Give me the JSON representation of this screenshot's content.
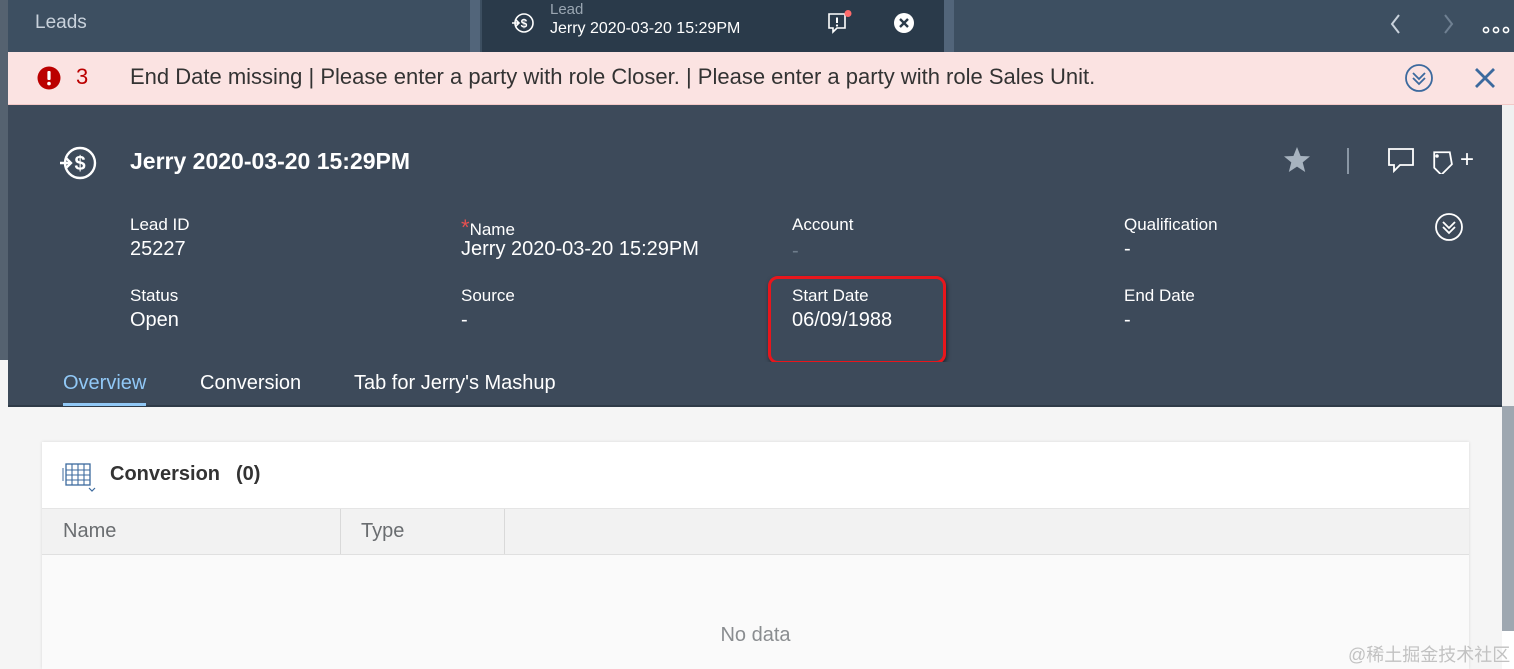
{
  "shell": {
    "leads_label": "Leads",
    "tab_caption": "Lead",
    "tab_title": "Jerry 2020-03-20 15:29PM"
  },
  "message_strip": {
    "count": "3",
    "text": "End Date missing | Please enter a party with role Closer. | Please enter a party with role Sales Unit."
  },
  "header": {
    "title": "Jerry 2020-03-20 15:29PM",
    "fields": {
      "lead_id": {
        "label": "Lead ID",
        "value": "25227"
      },
      "name": {
        "required_mark": "*",
        "label": "Name",
        "value": "Jerry 2020-03-20 15:29PM"
      },
      "account": {
        "label": "Account",
        "value": "-"
      },
      "qualification": {
        "label": "Qualification",
        "value": "-"
      },
      "status": {
        "label": "Status",
        "value": "Open"
      },
      "source": {
        "label": "Source",
        "value": "-"
      },
      "start_date": {
        "label": "Start Date",
        "value": "06/09/1988"
      },
      "end_date": {
        "label": "End Date",
        "value": "-"
      }
    },
    "plus_label": "+"
  },
  "tabs": [
    {
      "label": "Overview",
      "active": true
    },
    {
      "label": "Conversion",
      "active": false
    },
    {
      "label": "Tab for Jerry's Mashup",
      "active": false
    }
  ],
  "conversion_table": {
    "title": "Conversion",
    "count": "(0)",
    "columns": [
      "Name",
      "Type"
    ],
    "empty_text": "No data"
  },
  "watermark": "@稀土掘金技术社区",
  "colors": {
    "shell": "#3d4f61",
    "header": "#3d4a5a",
    "error": "#bb0000",
    "strip": "#fbe3e2",
    "active_tab": "#91c8f6",
    "highlight": "#e8161c"
  }
}
